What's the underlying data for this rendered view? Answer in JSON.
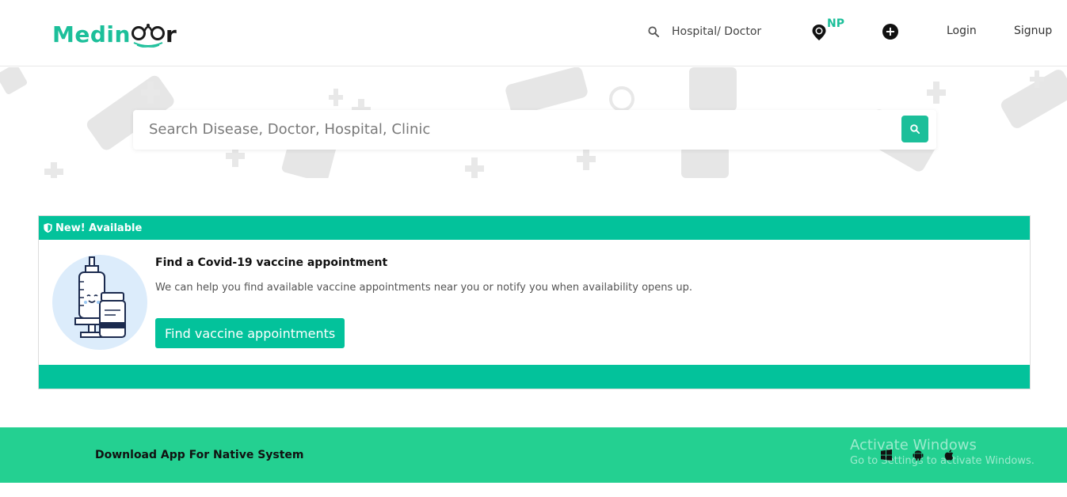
{
  "header": {
    "logo_text_left": "Medin",
    "logo_text_right": "r",
    "search_label": "Hospital/ Doctor",
    "country_code": "NP",
    "add_symbol": "+",
    "login_label": "Login",
    "signup_label": "Signup"
  },
  "hero": {
    "search_placeholder": "Search Disease, Doctor, Hospital, Clinic"
  },
  "card": {
    "badge_label": "New! Available",
    "title": "Find a Covid-19 vaccine appointment",
    "description": "We can help you find available vaccine appointments near you or notify you when availability opens up.",
    "button_label": "Find vaccine appointments"
  },
  "footer": {
    "download_label": "Download App For Native System",
    "platforms": [
      "windows-icon",
      "android-icon",
      "apple-icon"
    ]
  },
  "watermark": {
    "line1": "Activate Windows",
    "line2": "Go to Settings to activate Windows."
  },
  "colors": {
    "brand": "#1cbf9a",
    "card_accent": "#03c29b",
    "download_band": "#24d091"
  },
  "icons": {
    "search": "search-icon",
    "location": "location-pin-icon",
    "add": "plus-circle-icon",
    "shield": "shield-icon",
    "vaccine": "vaccine-illustration"
  }
}
